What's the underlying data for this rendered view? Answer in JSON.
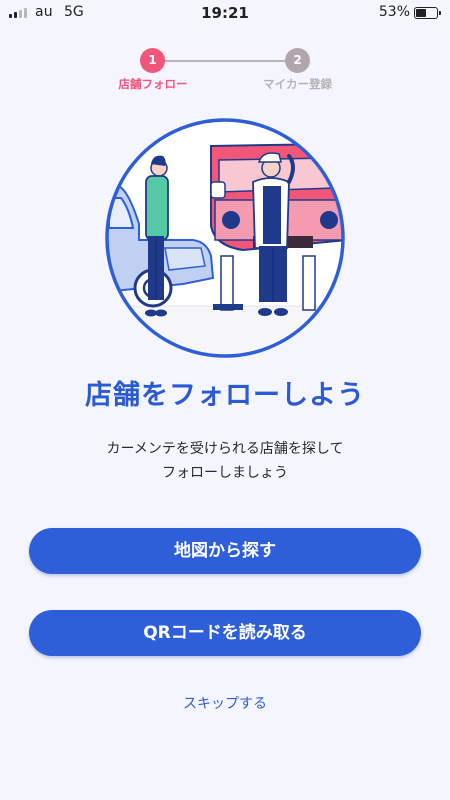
{
  "status_bar": {
    "carrier": "au",
    "network": "5G",
    "time": "19:21",
    "battery_percent": "53%",
    "battery_level": 0.53,
    "signal_bars": 2,
    "signal_total": 4
  },
  "stepper": {
    "steps": [
      {
        "number": "1",
        "label": "店舗フォロー",
        "active": true
      },
      {
        "number": "2",
        "label": "マイカー登録",
        "active": false
      }
    ]
  },
  "illustration": {
    "icon": "car-maintenance-illustration"
  },
  "main": {
    "headline": "店舗をフォローしよう",
    "description_line1": "カーメンテを受けられる店舗を探して",
    "description_line2": "フォローしましょう"
  },
  "actions": {
    "map_button_label": "地図から探す",
    "qr_button_label": "QRコードを読み取る",
    "skip_label": "スキップする"
  },
  "colors": {
    "accent_blue": "#2E5FD8",
    "active_step_pink": "#F0557A",
    "inactive_step_gray": "#B0A6AC",
    "background": "#F4F5FE"
  }
}
